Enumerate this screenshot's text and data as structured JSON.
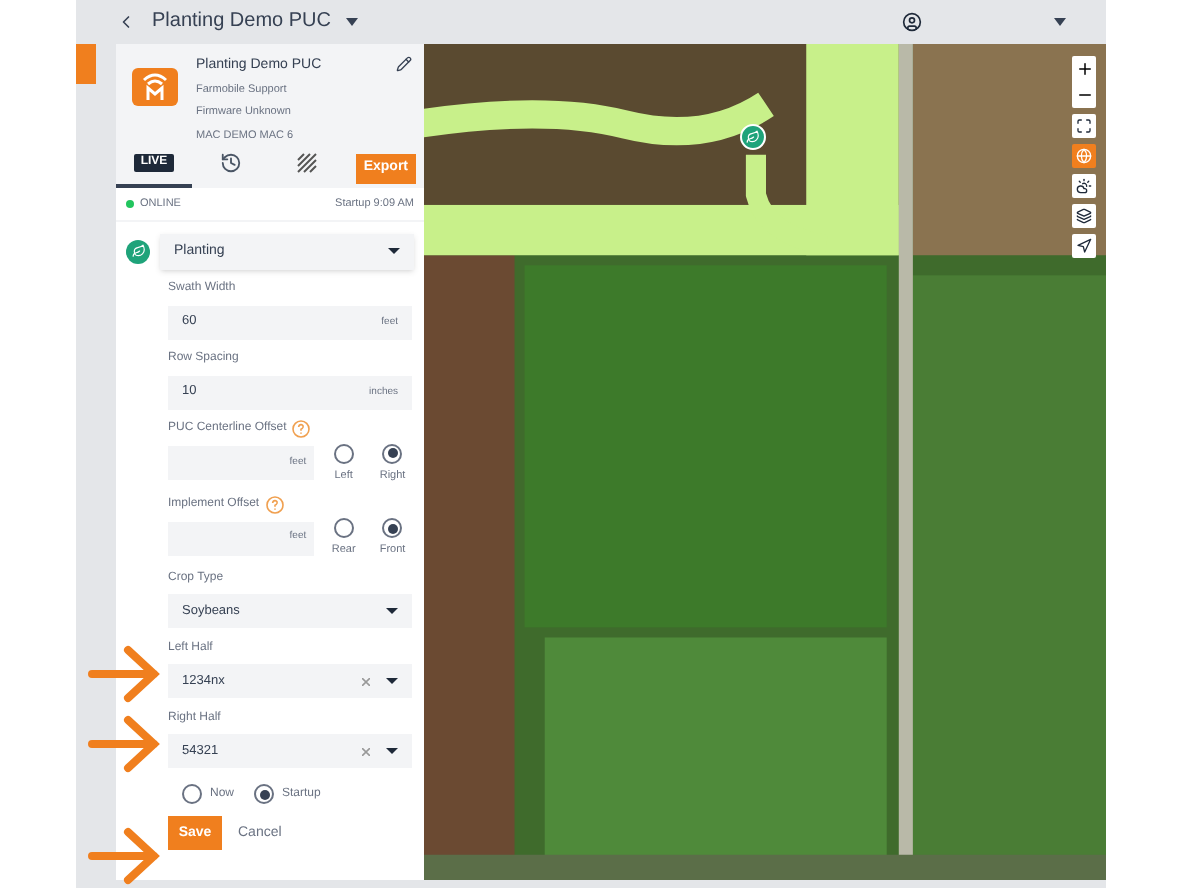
{
  "header": {
    "title": "Planting Demo PUC"
  },
  "device": {
    "name": "Planting Demo PUC",
    "lines": [
      "Farmobile Support",
      "Firmware Unknown",
      "MAC DEMO MAC 6"
    ]
  },
  "tabs": [
    {
      "kind": "live",
      "label": "LIVE",
      "selected": true
    },
    {
      "kind": "history",
      "selected": false
    },
    {
      "kind": "coverage",
      "selected": false
    }
  ],
  "export_button": "Export",
  "status": {
    "label": "ONLINE",
    "online": true,
    "startup": "Startup 9:09 AM"
  },
  "operation": {
    "value": "Planting"
  },
  "fields": [
    {
      "kind": "input",
      "label": "Swath Width",
      "value": "60",
      "unit": "feet"
    },
    {
      "kind": "input",
      "label": "Row Spacing",
      "value": "10",
      "unit": "inches"
    },
    {
      "kind": "offset",
      "label": "PUC Centerline Offset",
      "unit": "feet",
      "options": [
        {
          "label": "Left",
          "selected": false
        },
        {
          "label": "Right",
          "selected": true
        }
      ]
    },
    {
      "kind": "offset",
      "label": "Implement Offset",
      "unit": "feet",
      "options": [
        {
          "label": "Rear",
          "selected": false
        },
        {
          "label": "Front",
          "selected": true
        }
      ]
    },
    {
      "kind": "select",
      "label": "Crop Type",
      "value": "Soybeans",
      "clearable": false
    },
    {
      "kind": "select",
      "label": "Left Half",
      "value": "1234nx",
      "clearable": true
    },
    {
      "kind": "select",
      "label": "Right Half",
      "value": "54321",
      "clearable": true
    }
  ],
  "apply": [
    {
      "label": "Now",
      "selected": false
    },
    {
      "label": "Startup",
      "selected": true
    }
  ],
  "save_button": "Save",
  "cancel_button": "Cancel"
}
